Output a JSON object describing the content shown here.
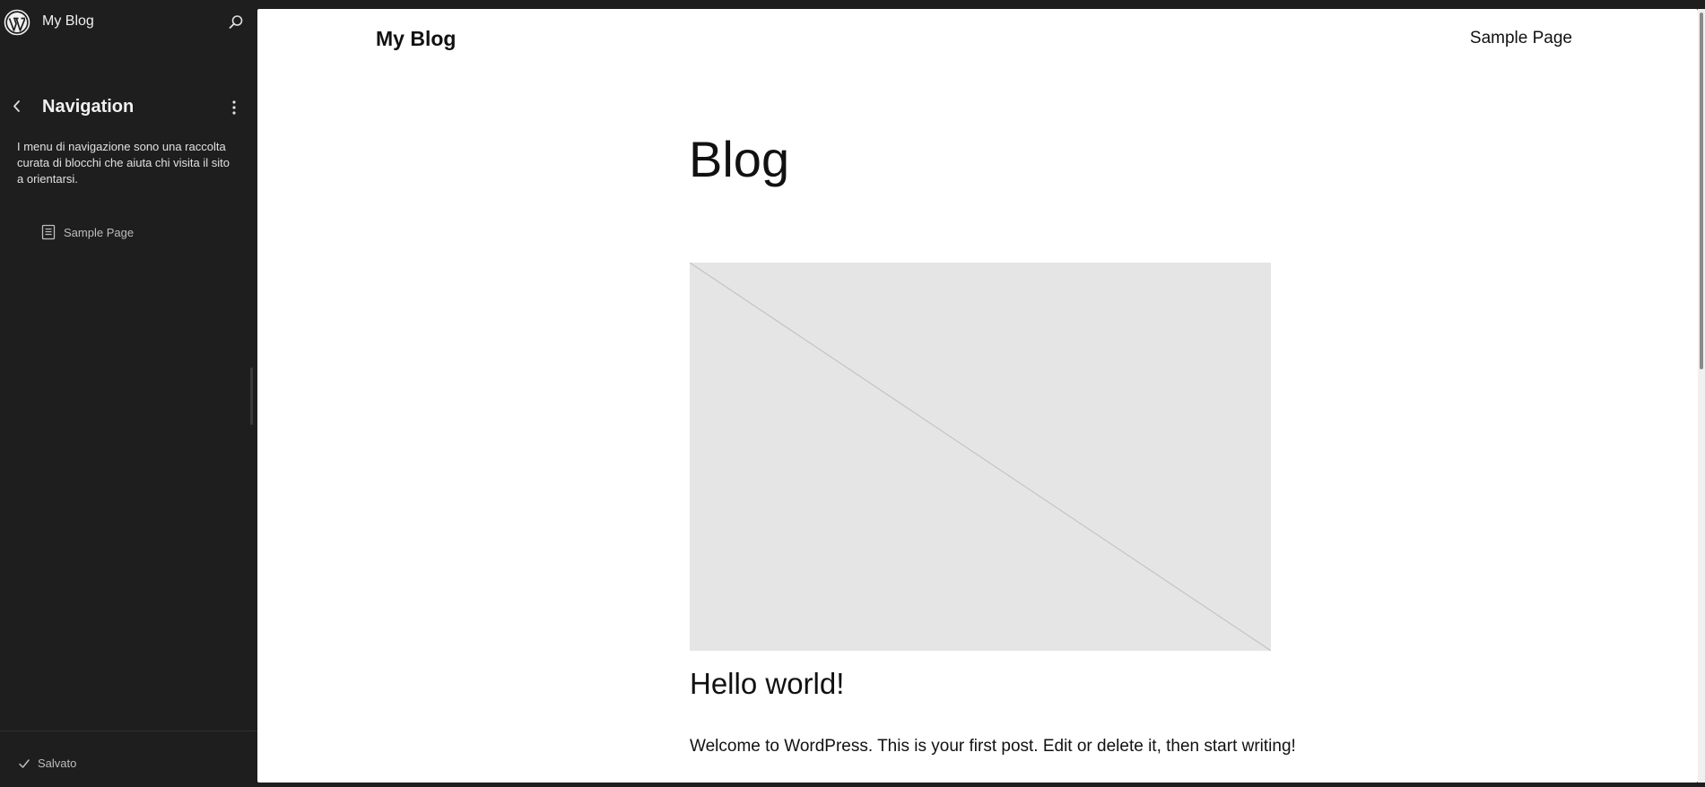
{
  "sidebar": {
    "site_title": "My Blog",
    "navigation": {
      "title": "Navigation",
      "description": "I menu di navigazione sono una raccolta curata di blocchi che aiuta chi visita il sito a orientarsi.",
      "items": [
        {
          "label": "Sample Page",
          "icon": "page-icon"
        }
      ]
    },
    "footer": {
      "status_label": "Salvato",
      "status_icon": "check-icon"
    },
    "icons": {
      "logo": "wordpress-logo-icon",
      "search": "search-icon",
      "back": "chevron-left-icon",
      "more": "more-vertical-icon"
    }
  },
  "canvas": {
    "header": {
      "site_name": "My Blog",
      "nav_link": "Sample Page"
    },
    "page_heading": "Blog",
    "post": {
      "title": "Hello world!",
      "excerpt": "Welcome to WordPress. This is your first post. Edit or delete it, then start writing!"
    }
  },
  "colors": {
    "sidebar_bg": "#1e1e1e",
    "canvas_bg": "#ffffff",
    "placeholder_bg": "#e5e5e5",
    "text_dark": "#111111",
    "text_light": "#f0f0f0"
  }
}
